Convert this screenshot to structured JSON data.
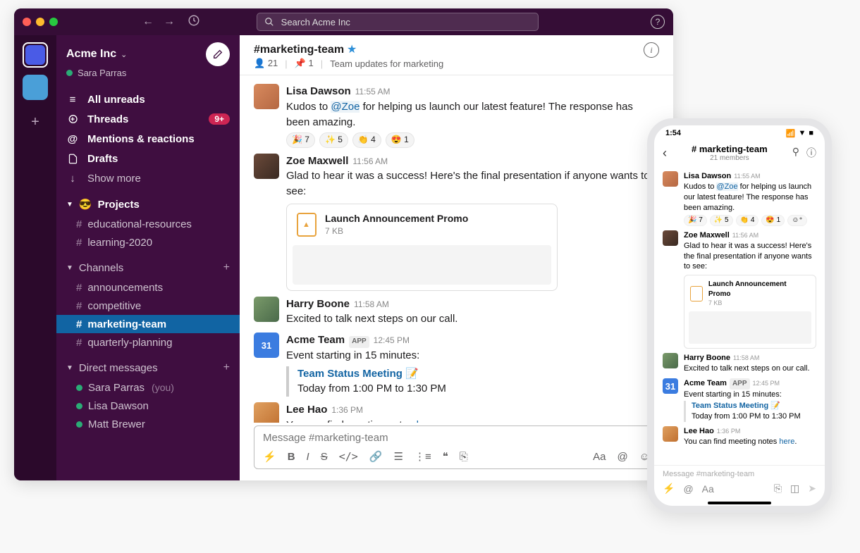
{
  "topbar": {
    "search_placeholder": "Search Acme Inc"
  },
  "workspace": {
    "name": "Acme Inc",
    "user": "Sara Parras"
  },
  "nav": {
    "unreads": "All unreads",
    "threads": "Threads",
    "threads_badge": "9+",
    "mentions": "Mentions & reactions",
    "drafts": "Drafts",
    "show_more": "Show more"
  },
  "sections": {
    "projects": {
      "label": "Projects",
      "emoji": "😎",
      "items": [
        "educational-resources",
        "learning-2020"
      ]
    },
    "channels": {
      "label": "Channels",
      "items": [
        "announcements",
        "competitive",
        "marketing-team",
        "quarterly-planning"
      ],
      "active": "marketing-team"
    },
    "dms": {
      "label": "Direct messages",
      "items": [
        {
          "name": "Sara Parras",
          "you": true
        },
        {
          "name": "Lisa Dawson",
          "you": false
        },
        {
          "name": "Matt Brewer",
          "you": false
        }
      ]
    }
  },
  "channel": {
    "name": "#marketing-team",
    "starred": true,
    "members": "21",
    "pins": "1",
    "topic": "Team updates for marketing"
  },
  "messages": [
    {
      "id": "m1",
      "author": "Lisa Dawson",
      "time": "11:55 AM",
      "avatar": "av-lisa",
      "parts": [
        {
          "t": "Kudos to "
        },
        {
          "t": "@Zoe",
          "mention": true
        },
        {
          "t": " for helping us launch our latest feature! The response has been amazing."
        }
      ],
      "reactions": [
        {
          "e": "🎉",
          "c": "7"
        },
        {
          "e": "✨",
          "c": "5"
        },
        {
          "e": "👏",
          "c": "4"
        },
        {
          "e": "😍",
          "c": "1"
        }
      ]
    },
    {
      "id": "m2",
      "author": "Zoe Maxwell",
      "time": "11:56 AM",
      "avatar": "av-zoe",
      "parts": [
        {
          "t": "Glad to hear it was a success! Here's the final presentation if anyone wants to see:"
        }
      ],
      "file": {
        "name": "Launch Announcement Promo",
        "size": "7 KB"
      }
    },
    {
      "id": "m3",
      "author": "Harry Boone",
      "time": "11:58 AM",
      "avatar": "av-harry",
      "parts": [
        {
          "t": "Excited to talk next steps on our call."
        }
      ]
    },
    {
      "id": "m4",
      "author": "Acme Team",
      "time": "12:45 PM",
      "avatar": "av-cal",
      "app": true,
      "cal": "31",
      "parts": [
        {
          "t": "Event starting in 15 minutes:"
        }
      ],
      "event": {
        "title": "Team Status Meeting",
        "emoji": "📝",
        "time": "Today from 1:00 PM to 1:30 PM"
      }
    },
    {
      "id": "m5",
      "author": "Lee Hao",
      "time": "1:36 PM",
      "avatar": "av-lee",
      "parts": [
        {
          "t": "You can find meeting notes "
        },
        {
          "t": "here",
          "link": true
        },
        {
          "t": "."
        }
      ]
    }
  ],
  "composer": {
    "placeholder": "Message #marketing-team"
  },
  "mobile": {
    "time": "1:54",
    "title": "# marketing-team",
    "subtitle": "21 members",
    "composer": "Message #marketing-team"
  }
}
